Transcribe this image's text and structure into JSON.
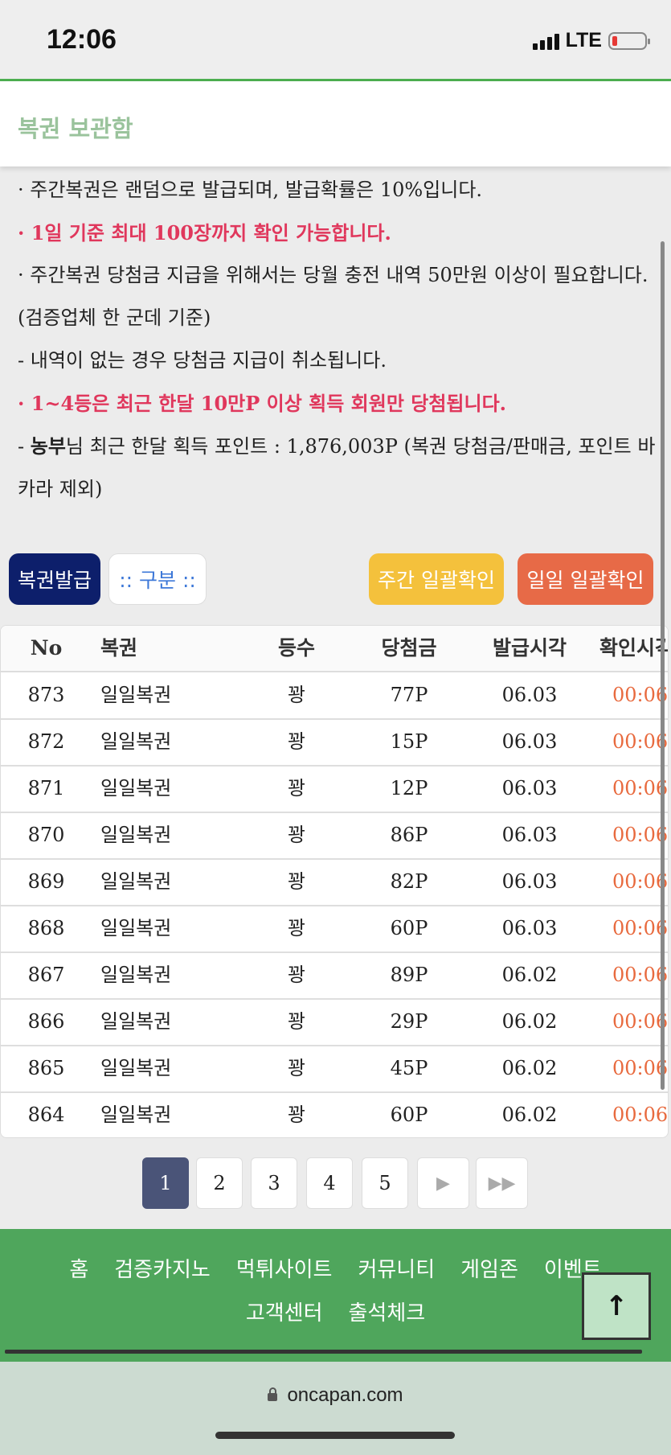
{
  "status_bar": {
    "time": "12:06",
    "network": "LTE"
  },
  "header": {
    "title": "복권 보관함"
  },
  "notices": [
    {
      "text": "· 주간복권은 랜덤으로 발급되며, 발급확률은 10%입니다.",
      "style": "normal"
    },
    {
      "text": "· 1일 기준 최대 100장까지 확인 가능합니다.",
      "style": "red"
    },
    {
      "text": "· 주간복권 당첨금 지급을 위해서는 당월 충전 내역 50만원 이상이 필요합니다. (검증업체 한 군데 기준)",
      "style": "normal"
    },
    {
      "text": " - 내역이 없는 경우 당첨금 지급이 취소됩니다.",
      "style": "normal"
    },
    {
      "text": "· 1~4등은 최근 한달 10만P 이상 획득 회원만 당첨됩니다.",
      "style": "red"
    }
  ],
  "points_notice": {
    "prefix": " - ",
    "user": "농부",
    "suffix": "님 최근 한달 획득 포인트 : 1,876,003P (복권 당첨금/판매금, 포인트 바카라 제외)"
  },
  "toolbar": {
    "issue_label": "복권발급",
    "select_label": ":: 구분 ::",
    "weekly_check_label": "주간 일괄확인",
    "daily_check_label": "일일 일괄확인"
  },
  "table": {
    "headers": {
      "no": "No",
      "ticket": "복권",
      "rank": "등수",
      "prize": "당첨금",
      "issued": "발급시각",
      "checked": "확인시각"
    },
    "rows": [
      {
        "no": "873",
        "ticket": "일일복권",
        "rank": "꽝",
        "prize": "77P",
        "issued": "06.03",
        "checked": "00:06"
      },
      {
        "no": "872",
        "ticket": "일일복권",
        "rank": "꽝",
        "prize": "15P",
        "issued": "06.03",
        "checked": "00:06"
      },
      {
        "no": "871",
        "ticket": "일일복권",
        "rank": "꽝",
        "prize": "12P",
        "issued": "06.03",
        "checked": "00:06"
      },
      {
        "no": "870",
        "ticket": "일일복권",
        "rank": "꽝",
        "prize": "86P",
        "issued": "06.03",
        "checked": "00:06"
      },
      {
        "no": "869",
        "ticket": "일일복권",
        "rank": "꽝",
        "prize": "82P",
        "issued": "06.03",
        "checked": "00:06"
      },
      {
        "no": "868",
        "ticket": "일일복권",
        "rank": "꽝",
        "prize": "60P",
        "issued": "06.03",
        "checked": "00:06"
      },
      {
        "no": "867",
        "ticket": "일일복권",
        "rank": "꽝",
        "prize": "89P",
        "issued": "06.02",
        "checked": "00:06"
      },
      {
        "no": "866",
        "ticket": "일일복권",
        "rank": "꽝",
        "prize": "29P",
        "issued": "06.02",
        "checked": "00:06"
      },
      {
        "no": "865",
        "ticket": "일일복권",
        "rank": "꽝",
        "prize": "45P",
        "issued": "06.02",
        "checked": "00:06"
      },
      {
        "no": "864",
        "ticket": "일일복권",
        "rank": "꽝",
        "prize": "60P",
        "issued": "06.02",
        "checked": "00:06"
      }
    ]
  },
  "pagination": {
    "pages": [
      "1",
      "2",
      "3",
      "4",
      "5"
    ],
    "current": "1"
  },
  "footer": {
    "links": [
      "홈",
      "검증카지노",
      "먹튀사이트",
      "커뮤니티",
      "게임존",
      "이벤트",
      "고객센터",
      "출석체크"
    ]
  },
  "browser": {
    "url": "oncapan.com"
  },
  "colors": {
    "accent_green": "#4fa65c",
    "header_title": "#9ac39c",
    "notice_red": "#e0375c",
    "issue_button": "#0d1f6b",
    "weekly_button": "#f4c13c",
    "daily_button": "#e76a47",
    "checked_time": "#e86a3e"
  }
}
